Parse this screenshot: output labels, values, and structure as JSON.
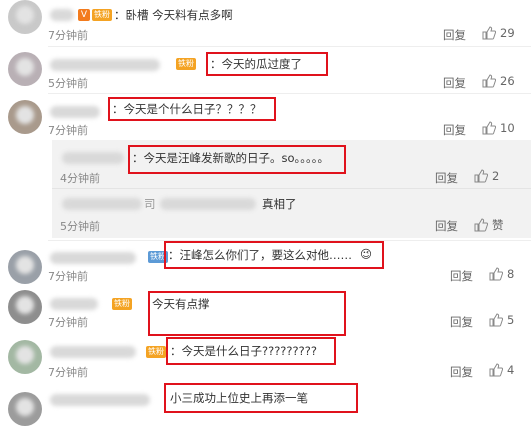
{
  "comments": [
    {
      "text": "：卧槽 今天料有点多啊",
      "time": "7分钟前",
      "reply": "回复",
      "likes": "29",
      "badge": "铁粉"
    },
    {
      "text": "：今天的瓜过度了",
      "time": "5分钟前",
      "reply": "回复",
      "likes": "26",
      "badge": "铁粉"
    },
    {
      "text": "：今天是个什么日子？？？？",
      "time": "7分钟前",
      "reply": "回复",
      "likes": "10"
    },
    {
      "text": "：汪峰怎么你们了，要这么对他……",
      "time": "7分钟前",
      "reply": "回复",
      "likes": "8",
      "badge": "铁粉",
      "emoji": "😉"
    },
    {
      "text": "今天有点撑",
      "time": "7分钟前",
      "reply": "回复",
      "likes": "5",
      "badge": "铁粉"
    },
    {
      "text": "：今天是什么日子?????????",
      "time": "7分钟前",
      "reply": "回复",
      "likes": "4",
      "badge": "铁粉"
    },
    {
      "text": "小三成功上位史上再添一笔",
      "time": "",
      "reply": "",
      "likes": ""
    }
  ],
  "subreplies": [
    {
      "text": "：今天是汪峰发新歌的日子。so。。。。。",
      "time": "4分钟前",
      "reply": "回复",
      "likes": "2"
    },
    {
      "text_prefix": "司",
      "text": "真相了",
      "time": "5分钟前",
      "reply": "回复",
      "likes": "赞"
    }
  ]
}
